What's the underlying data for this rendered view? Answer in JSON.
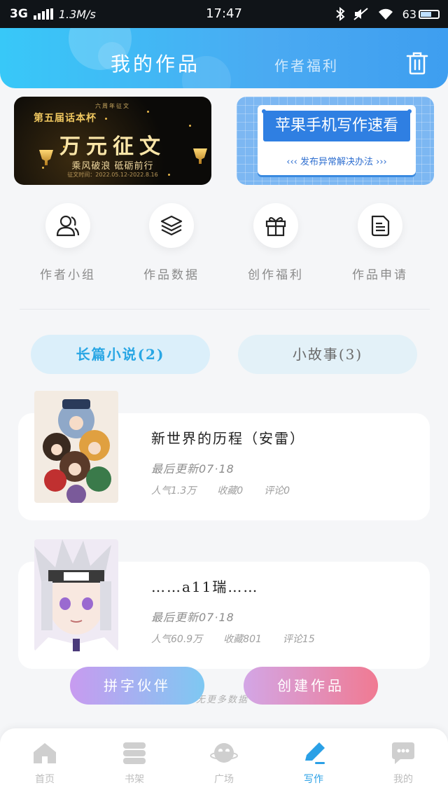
{
  "status_bar": {
    "network": "3G",
    "speed": "1.3M/s",
    "time": "17:47",
    "battery": "63",
    "battery_level": 0.63
  },
  "header": {
    "tab_active": "我的作品",
    "tab_other": "作者福利",
    "trash_icon": "trash-icon"
  },
  "banners": {
    "left": {
      "top_text": "六周年征文",
      "cup_text": "第五届话本杯",
      "title": "万元征文",
      "subtitle": "乘风破浪 砥砺前行",
      "date_text": "征文时间：2022.05.12-2022.8.16"
    },
    "right": {
      "title": "苹果手机写作速看",
      "subtitle": "发布异常解决办法"
    }
  },
  "quick_icons": [
    {
      "label": "作者小组",
      "icon": "users-icon"
    },
    {
      "label": "作品数据",
      "icon": "layers-icon"
    },
    {
      "label": "创作福利",
      "icon": "gift-icon"
    },
    {
      "label": "作品申请",
      "icon": "document-icon"
    }
  ],
  "categories": {
    "active": "长篇小说(2)",
    "idle": "小故事(3)"
  },
  "works": [
    {
      "title": "新世界的历程（安雷）",
      "updated": "最后更新07·18",
      "popularity": "人气1.3万",
      "favorites": "收藏0",
      "comments": "评论0"
    },
    {
      "title": "……a11瑞……",
      "updated": "最后更新07·18",
      "popularity": "人气60.9万",
      "favorites": "收藏801",
      "comments": "评论15"
    }
  ],
  "buttons": {
    "partner": "拼字伙伴",
    "create": "创建作品"
  },
  "no_more": "无更多数据",
  "nav": [
    {
      "label": "首页",
      "icon": "home-icon"
    },
    {
      "label": "书架",
      "icon": "bookshelf-icon"
    },
    {
      "label": "广场",
      "icon": "planet-icon"
    },
    {
      "label": "写作",
      "icon": "pen-icon"
    },
    {
      "label": "我的",
      "icon": "chat-icon"
    }
  ],
  "colors": {
    "accent": "#2aa0e6",
    "header_from": "#38c8f8",
    "header_to": "#3e9ef0",
    "create_button": "#f07a92"
  }
}
